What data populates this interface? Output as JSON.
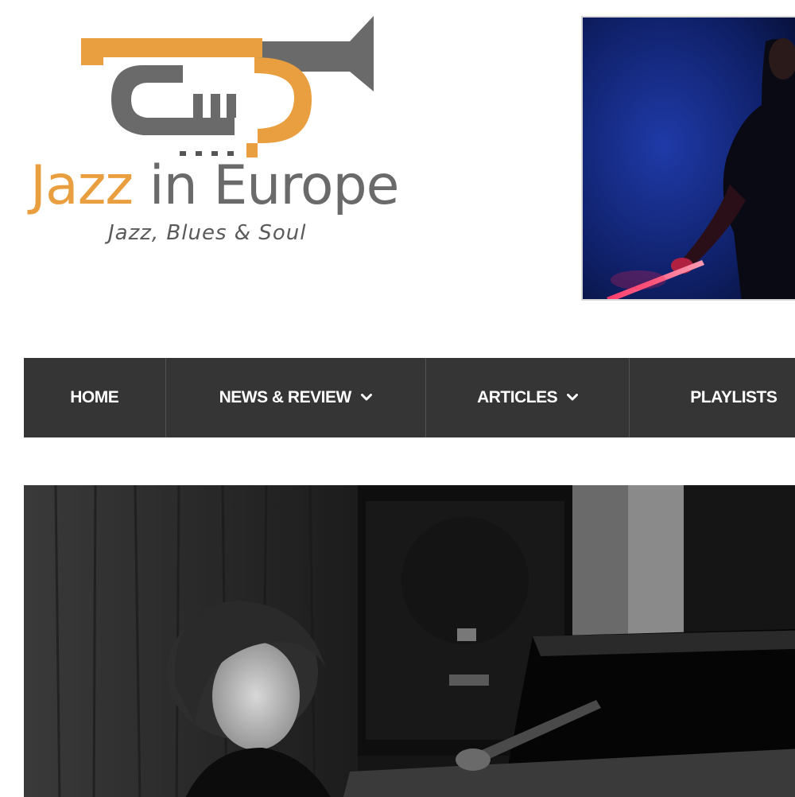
{
  "logo": {
    "title_word1": "Jazz",
    "title_word2": " in Europe",
    "tagline": "Jazz, Blues & Soul",
    "colors": {
      "orange": "#e99f3f",
      "gray": "#6a6a6a",
      "teal": "#3a9a7a"
    }
  },
  "nav": {
    "items": [
      {
        "label": "HOME",
        "has_dropdown": false
      },
      {
        "label": "NEWS & REVIEW",
        "has_dropdown": true
      },
      {
        "label": "ARTICLES",
        "has_dropdown": true
      },
      {
        "label": "PLAYLISTS",
        "has_dropdown": false
      }
    ],
    "background": "#353535"
  },
  "icons": {
    "logo": "trumpet-logo-icon",
    "dropdown": "chevron-down-icon"
  }
}
